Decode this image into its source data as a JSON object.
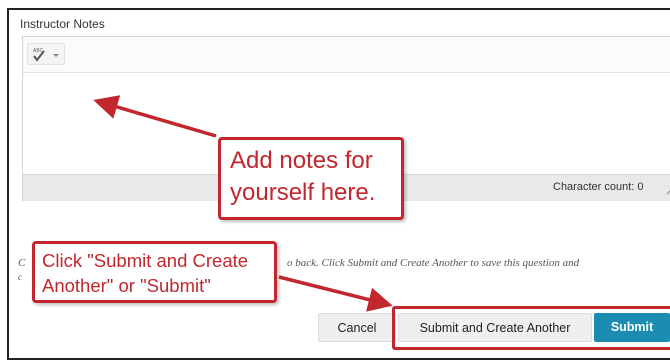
{
  "editor": {
    "label": "Instructor Notes",
    "character_count_label": "Character count: 0"
  },
  "instructions": {
    "left_fragment": "C",
    "left_fragment_line2": "c",
    "right_fragment": "o back. Click Submit and Create Another to save this question and"
  },
  "callouts": {
    "notes": [
      "Add notes for",
      "yourself here."
    ],
    "submit": [
      "Click \"Submit and Create",
      "Another\" or \"Submit\""
    ]
  },
  "buttons": {
    "cancel": "Cancel",
    "submit_and_create_another": "Submit and Create Another",
    "submit": "Submit"
  },
  "colors": {
    "callout_red": "#c1272d",
    "submit_blue": "#1a8db0"
  },
  "icons": {
    "spellcheck": "spellcheck-icon",
    "dropdown": "chevron-down-icon",
    "resize": "resize-grip-icon"
  }
}
